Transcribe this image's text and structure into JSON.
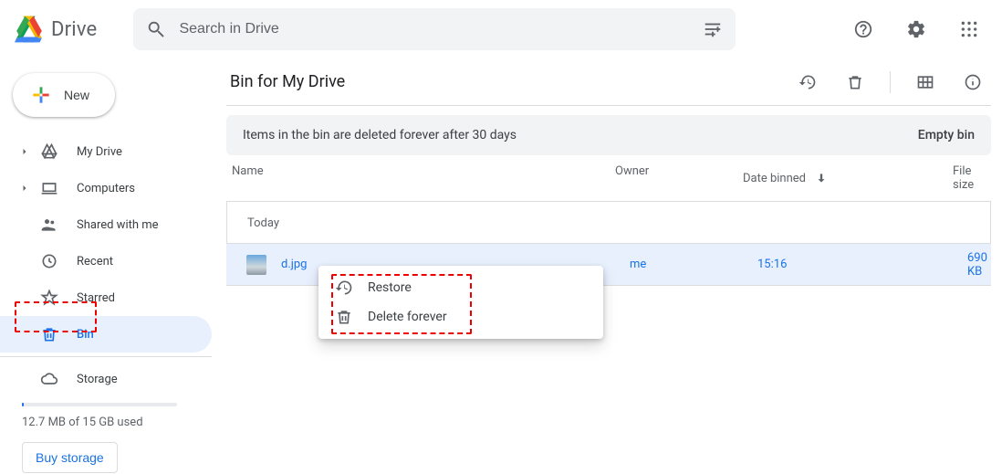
{
  "app": {
    "name": "Drive"
  },
  "search": {
    "placeholder": "Search in Drive"
  },
  "sidebar": {
    "new_label": "New",
    "items": [
      {
        "label": "My Drive"
      },
      {
        "label": "Computers"
      },
      {
        "label": "Shared with me"
      },
      {
        "label": "Recent"
      },
      {
        "label": "Starred"
      },
      {
        "label": "Bin"
      },
      {
        "label": "Storage"
      }
    ],
    "storage_text": "12.7 MB of 15 GB used",
    "buy_label": "Buy storage"
  },
  "main": {
    "title": "Bin for My Drive",
    "banner_text": "Items in the bin are deleted forever after 30 days",
    "empty_label": "Empty bin",
    "columns": {
      "name": "Name",
      "owner": "Owner",
      "binned": "Date binned",
      "size": "File size"
    },
    "group_header": "Today",
    "rows": [
      {
        "name": "d.jpg",
        "owner": "me",
        "time": "15:16",
        "size": "690 KB"
      }
    ]
  },
  "context_menu": {
    "restore": "Restore",
    "delete": "Delete forever"
  }
}
